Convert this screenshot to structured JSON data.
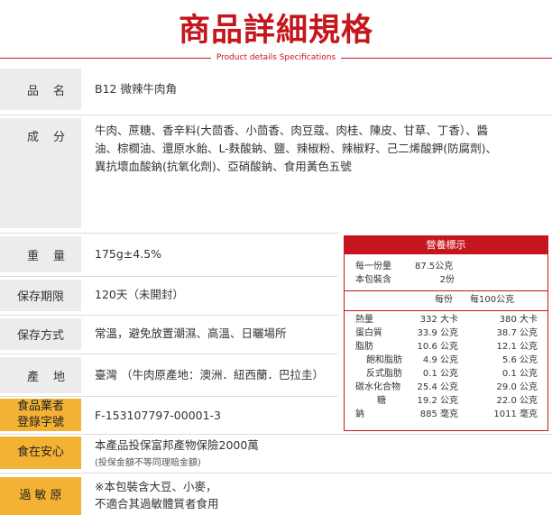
{
  "header": {
    "title": "商品詳細規格",
    "subtitle": "Product details Specifications"
  },
  "specs": {
    "name": {
      "label_chars": [
        "品",
        "名"
      ],
      "value": "B12 微辣牛肉角"
    },
    "ingredients": {
      "label_chars": [
        "成",
        "分"
      ],
      "lines": [
        "牛肉、蔗糖、香辛料(大茴香、小茴香、肉豆蔻、肉桂、陳皮、甘草、丁香）、醬",
        "油、棕櫚油、還原水飴、L-麩酸鈉、鹽、辣椒粉、辣椒籽、己二烯酸鉀(防腐劑)、",
        "異抗壞血酸鈉(抗氧化劑)、亞硝酸鈉、食用黃色五號"
      ]
    },
    "weight": {
      "label_chars": [
        "重",
        "量"
      ],
      "value": "175g±4.5%"
    },
    "shelf_life": {
      "label": "保存期限",
      "value": "120天（未開封）"
    },
    "storage": {
      "label": "保存方式",
      "value": "常溫，避免放置潮濕、高溫、日曬場所"
    },
    "origin": {
      "label_chars": [
        "產",
        "地"
      ],
      "value": "臺灣 （牛肉原產地：澳洲．紐西蘭．巴拉圭）"
    },
    "registration": {
      "label_lines": [
        "食品業者",
        "登錄字號"
      ],
      "value": "F-153107797-00001-3"
    },
    "insurance": {
      "label": "食在安心",
      "value": "本產品投保富邦產物保險2000萬",
      "note": "(投保金額不等同理賠金額)"
    },
    "allergen": {
      "label": "過 敏 原",
      "lines": [
        "※本包裝含大豆、小麥，",
        "不適合其過敏體質者食用"
      ]
    }
  },
  "nutrition": {
    "title": "營養標示",
    "serving_size_label": "每一份量",
    "serving_size_value": "87.5公克",
    "servings_label": "本包裝含",
    "servings_value": "2份",
    "col_per_serving": "每份",
    "col_per_100g": "每100公克",
    "rows": [
      {
        "name": "熱量",
        "per_serving": "332 大卡",
        "per_100g": "380 大卡"
      },
      {
        "name": "蛋白質",
        "per_serving": "33.9 公克",
        "per_100g": "38.7 公克"
      },
      {
        "name": "脂肪",
        "per_serving": "10.6 公克",
        "per_100g": "12.1 公克"
      },
      {
        "name": "飽和脂肪",
        "per_serving": "4.9 公克",
        "per_100g": "5.6 公克"
      },
      {
        "name": "反式脂肪",
        "per_serving": "0.1 公克",
        "per_100g": "0.1 公克"
      },
      {
        "name": "碳水化合物",
        "per_serving": "25.4 公克",
        "per_100g": "29.0 公克"
      },
      {
        "name": "糖",
        "per_serving": "19.2 公克",
        "per_100g": "22.0 公克"
      },
      {
        "name": "鈉",
        "per_serving": "885 毫克",
        "per_100g": "1011 毫克"
      }
    ]
  },
  "colors": {
    "brand_red": "#c4161c",
    "label_gray": "#ececec",
    "label_gold": "#f3b233"
  }
}
